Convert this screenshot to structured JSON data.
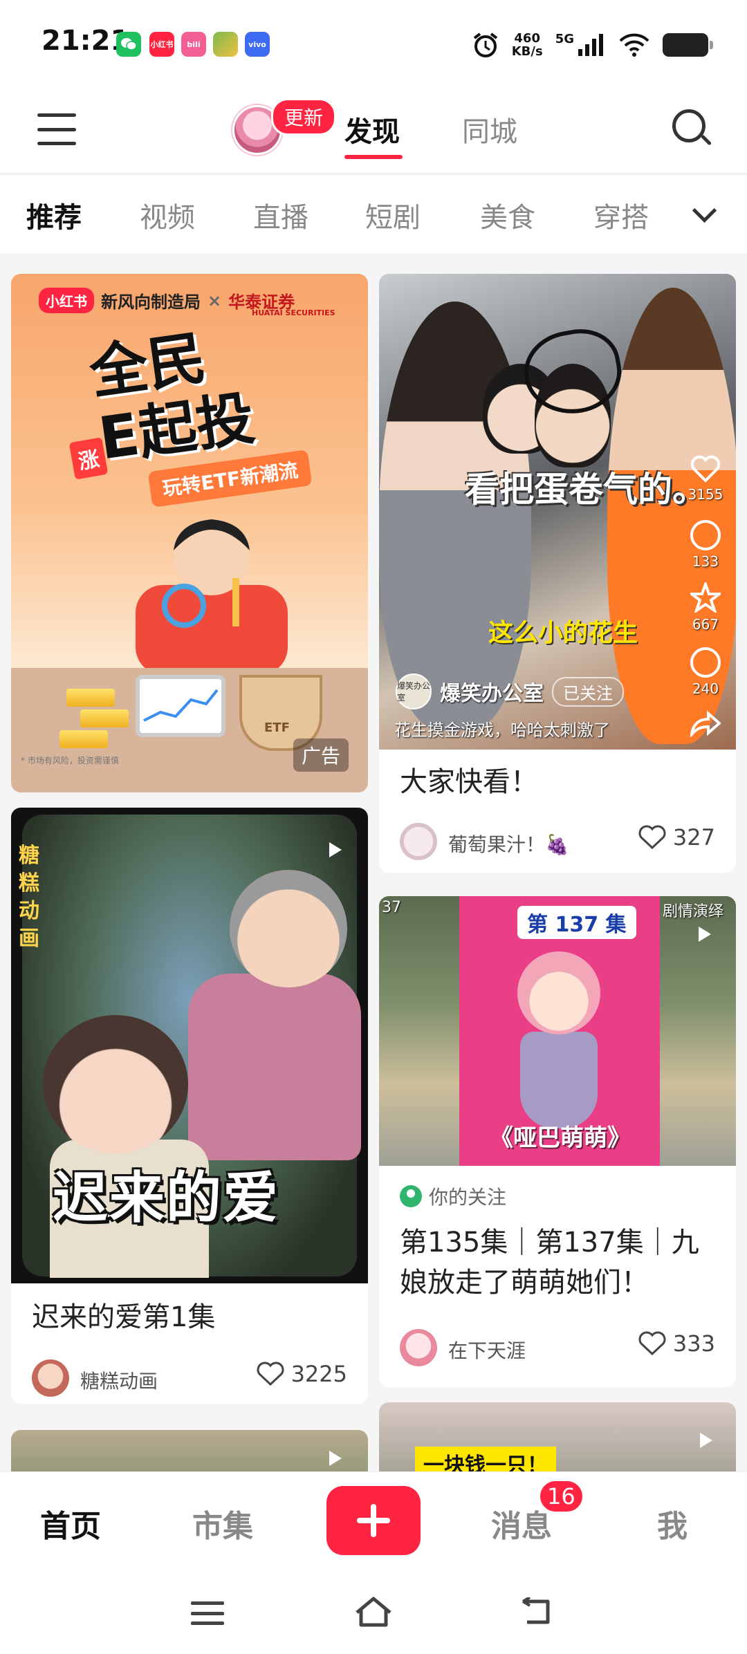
{
  "status_bar": {
    "time": "21:21",
    "net_speed_value": "460",
    "net_speed_unit": "KB/s",
    "signal_label": "5G",
    "notification_apps": [
      "wechat-icon",
      "xiaohongshu-icon",
      "bilibili-icon",
      "game-icon",
      "vivo-icon"
    ],
    "notif_xhs": "小红书",
    "notif_bili": "bili",
    "notif_vivo": "vivo"
  },
  "header": {
    "update_badge": "更新",
    "tab_discover": "发现",
    "tab_city": "同城"
  },
  "categories": [
    "推荐",
    "视频",
    "直播",
    "短剧",
    "美食",
    "穿搭"
  ],
  "feed": {
    "ad_card": {
      "brand_chip": "小红书",
      "brand_text": "新风向制造局",
      "times": "×",
      "partner": "华泰证券",
      "partner_en": "HUATAI SECURITIES",
      "headline_1": "全民",
      "headline_2": "E起投",
      "subline": "玩转ETF新潮流",
      "rise_label": "涨",
      "basket_label": "ETF",
      "ad_label": "广告",
      "fineprint": "* 市场有风险，投资需谨慎"
    },
    "video_card": {
      "caption": "看把蛋卷气的。",
      "caption2": "这么小的花生",
      "author_avatar_text": "爆笑办公室",
      "author": "爆笑办公室",
      "follow_status": "已关注",
      "desc": "花生摸金游戏，哈哈太刺激了",
      "stat_likes": "3155",
      "stat_comments": "133",
      "stat_collects": "667",
      "stat_shares": "240",
      "title": "大家快看！",
      "user": "葡萄果汁！🍇",
      "likes": "327"
    },
    "cartoon_card": {
      "brand_vertical": "糖糕动画",
      "cover_title": "迟来的爱",
      "title": "迟来的爱第1集",
      "user": "糖糕动画",
      "likes": "3225"
    },
    "anime_card": {
      "episode_badge": "第 137 集",
      "cover_name": "《哑巴萌萌》",
      "corner_left": "37",
      "corner_right": "剧情演绎",
      "follow_note": "你的关注",
      "title": "第135集｜第137集｜九娘放走了萌萌她们！",
      "user": "在下天涯",
      "likes": "333"
    },
    "partial_right": {
      "cover_text": "一块钱一只！"
    }
  },
  "bottom_nav": {
    "home": "首页",
    "market": "市集",
    "messages": "消息",
    "messages_badge": "16",
    "me": "我"
  },
  "colors": {
    "brand": "#ff2442"
  }
}
